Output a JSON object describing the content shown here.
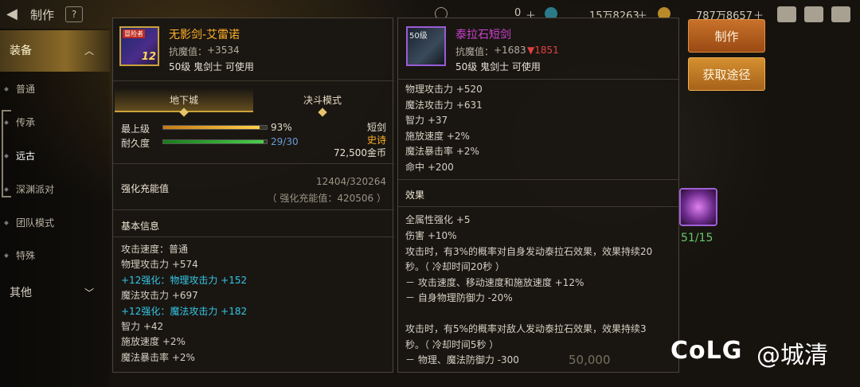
{
  "topbar": {
    "title": "制作",
    "help": "?",
    "currency1": "0",
    "currency2": "15万8263",
    "currency3": "787万8657"
  },
  "sidebar": {
    "equipment": "装备",
    "items": [
      "普通",
      "传承",
      "远古",
      "深渊派对",
      "团队模式",
      "特殊"
    ],
    "other": "其他"
  },
  "left_panel": {
    "icon_tag": "冒险者",
    "icon_level": "12",
    "name": "无影剑-艾雷诺",
    "resist_label": "抗魔值：",
    "resist_value": "+3534",
    "req": "50级 鬼剑士 可使用",
    "tab_dungeon": "地下城",
    "tab_duel": "决斗模式",
    "max_level_label": "最上级",
    "max_level_pct": "93%",
    "max_level_fraction": 0.93,
    "durability_label": "耐久度",
    "durability_value": "29/30",
    "durability_fraction": 0.967,
    "weapon_type": "短剑",
    "rarity": "史诗",
    "price": "72,500金币",
    "charge_value": "12404/320264",
    "charge_label": "强化充能值",
    "charge_sub": "（ 强化充能值：420506 ）",
    "basic_info": "基本信息",
    "attrs": [
      {
        "text": "攻击速度：普通",
        "cyan": false
      },
      {
        "text": "物理攻击力 +574",
        "cyan": false
      },
      {
        "text": "+12强化：物理攻击力 +152",
        "cyan": true
      },
      {
        "text": "魔法攻击力 +697",
        "cyan": false
      },
      {
        "text": "+12强化：魔法攻击力 +182",
        "cyan": true
      },
      {
        "text": "智力 +42",
        "cyan": false
      },
      {
        "text": "施放速度 +2%",
        "cyan": false
      },
      {
        "text": "魔法暴击率 +2%",
        "cyan": false
      }
    ]
  },
  "right_panel": {
    "icon_level": "50级",
    "name": "泰拉石短剑",
    "resist_label": "抗魔值：",
    "resist_value": "+1683",
    "resist_diff": "▼1851",
    "req": "50级 鬼剑士 可使用",
    "attrs": [
      "物理攻击力 +520",
      "魔法攻击力 +631",
      "智力 +37",
      "施放速度 +2%",
      "魔法暴击率 +2%",
      "命中 +200"
    ],
    "effect_title": "效果",
    "effects": [
      "全属性强化 +5",
      "伤害 +10%",
      "攻击时，有3%的概率对自身发动泰拉石效果，效果持续20",
      "秒。（ 冷却时间20秒 ）",
      " － 攻击速度、移动速度和施放速度 +12%",
      " － 自身物理防御力 -20%",
      "",
      "攻击时，有5%的概率对敌人发动泰拉石效果，效果持续3",
      "秒。（ 冷却时间5秒 ）",
      " － 物理、魔法防御力 -300"
    ]
  },
  "actions": {
    "craft": "制作",
    "source": "获取途径"
  },
  "material": {
    "count": "51/15"
  },
  "gold_cost": "50,000",
  "watermark": {
    "logo": "CoLG",
    "text": "@城清"
  },
  "colors": {
    "gold_name": "#ffb02a",
    "epic_name": "#d040d0",
    "cyan_attr": "#34c6e6",
    "resist_down": "#e04040"
  }
}
